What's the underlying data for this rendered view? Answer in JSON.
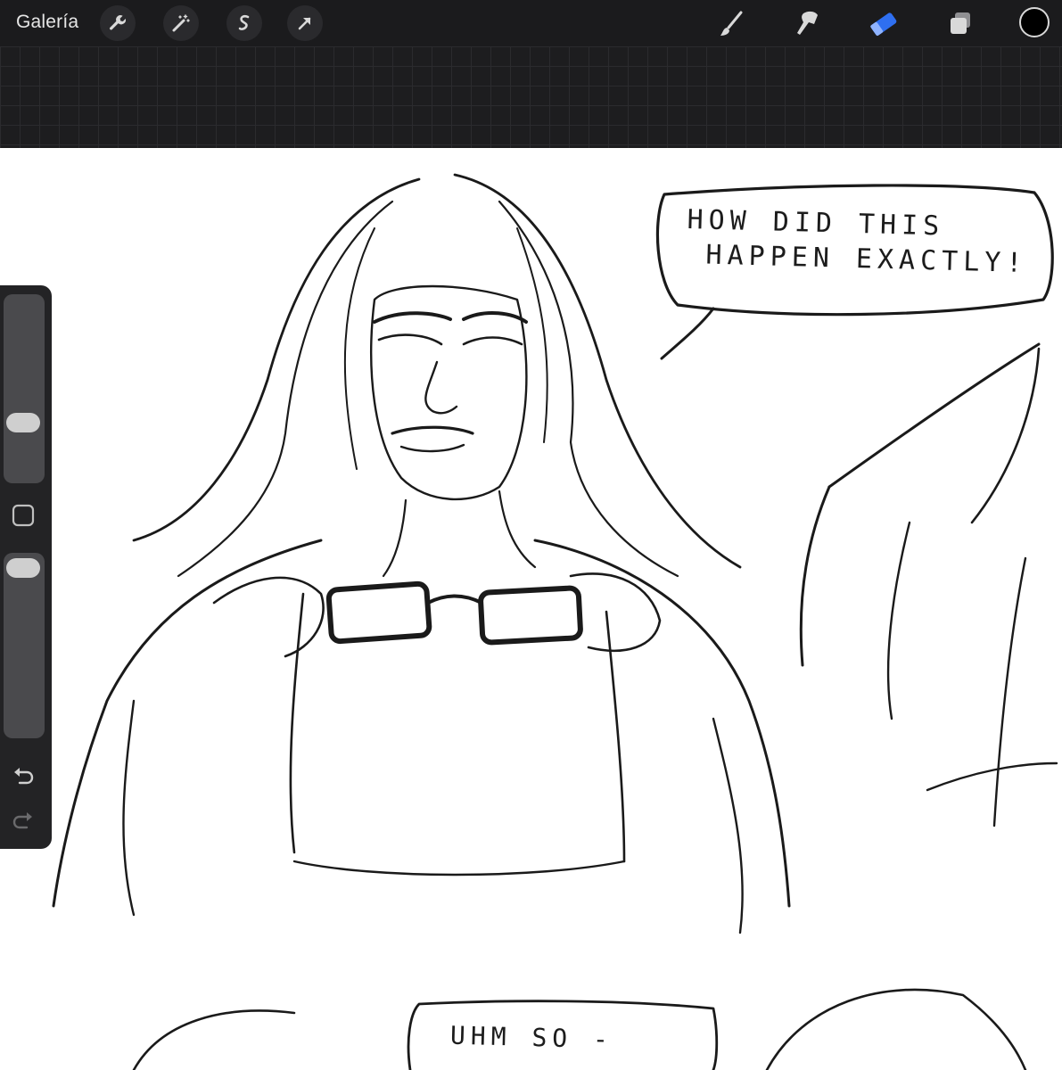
{
  "topbar": {
    "gallery_label": "Galería",
    "actions": [
      {
        "name": "actions-wrench"
      },
      {
        "name": "adjustments-magic-wand"
      },
      {
        "name": "selection-s"
      },
      {
        "name": "transform-arrow"
      }
    ],
    "tools": [
      {
        "name": "brush-icon"
      },
      {
        "name": "smudge-icon"
      },
      {
        "name": "eraser-icon",
        "active": true
      },
      {
        "name": "layers-icon"
      }
    ],
    "active_color": "#000000",
    "accent": "#2f6ff0"
  },
  "canvas": {
    "speech_bubble_1": {
      "line1": "HOW DID THIS",
      "line2": "HAPPEN EXACTLY!"
    },
    "speech_bubble_2": {
      "line1": "UHM SO -"
    }
  },
  "sidebar": {
    "brush_size_level": 0.3,
    "opacity_level": 0.97
  }
}
